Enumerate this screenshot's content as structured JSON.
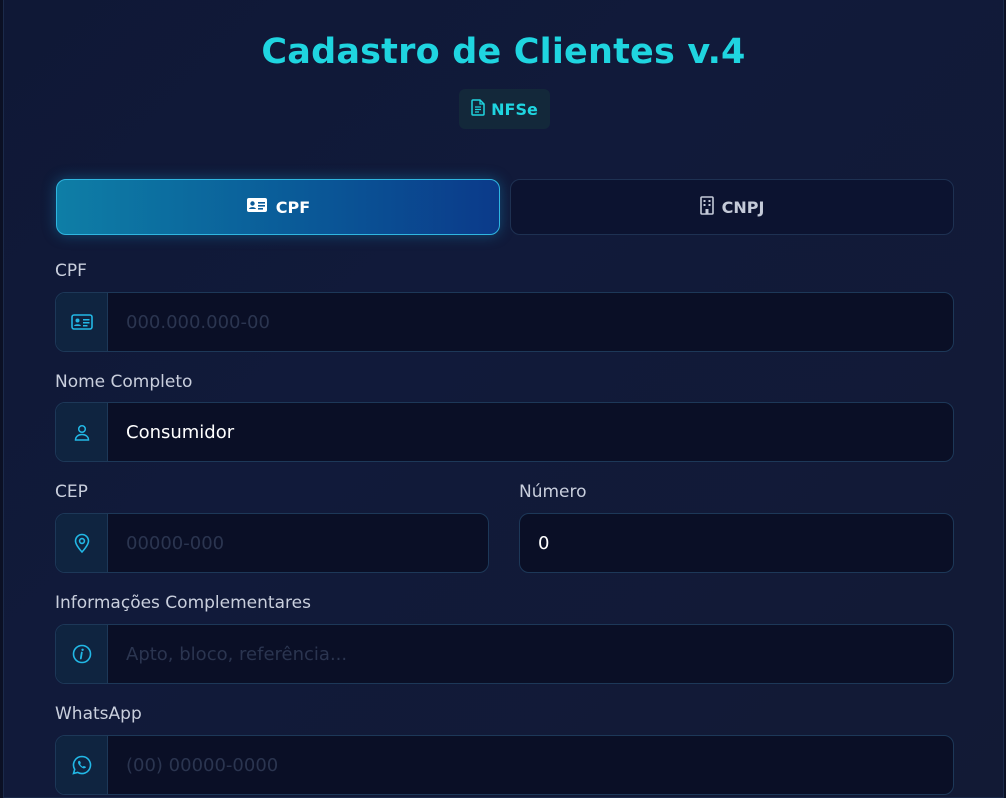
{
  "header": {
    "title": "Cadastro de Clientes v.4",
    "badge_label": "NFSe",
    "badge_icon": "document-icon"
  },
  "toggle": {
    "cpf_label": "CPF",
    "cnpj_label": "CNPJ",
    "selected": "CPF"
  },
  "form": {
    "cpf": {
      "label": "CPF",
      "value": "",
      "placeholder": "000.000.000-00",
      "icon": "id-card-icon"
    },
    "nome": {
      "label": "Nome Completo",
      "value": "Consumidor",
      "placeholder": "",
      "icon": "user-icon"
    },
    "cep": {
      "label": "CEP",
      "value": "",
      "placeholder": "00000-000",
      "icon": "map-pin-icon"
    },
    "numero": {
      "label": "Número",
      "value": "0",
      "placeholder": ""
    },
    "complemento": {
      "label": "Informações Complementares",
      "value": "",
      "placeholder": "Apto, bloco, referência...",
      "icon": "info-icon"
    },
    "whatsapp": {
      "label": "WhatsApp",
      "value": "",
      "placeholder": "(00) 00000-0000",
      "icon": "whatsapp-icon"
    }
  },
  "colors": {
    "accent": "#1fd5e0",
    "active_toggle": "#0a5a98",
    "field_bg": "#0a0f26",
    "icon": "#22b8e6"
  }
}
